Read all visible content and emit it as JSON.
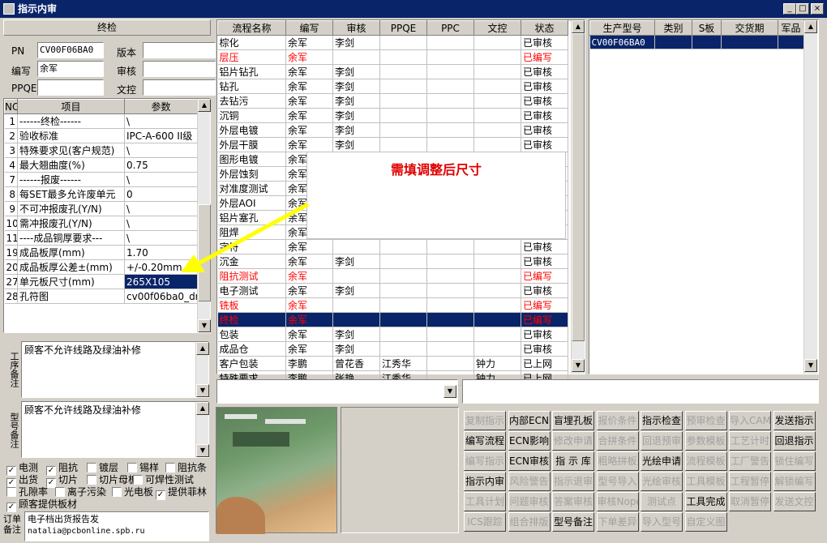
{
  "window": {
    "title": "指示内审",
    "min": "_",
    "max": "□",
    "close": "×"
  },
  "left_panel": {
    "section": "终检",
    "fields": [
      {
        "label": "PN",
        "value": "CV00F06BA0"
      },
      {
        "label": "版本",
        "value": ""
      },
      {
        "label": "编写",
        "value": "余军"
      },
      {
        "label": "审核",
        "value": ""
      },
      {
        "label": "PPQE",
        "value": ""
      },
      {
        "label": "文控",
        "value": ""
      }
    ],
    "params_headers": [
      "NO",
      "项目",
      "参数"
    ],
    "params": [
      {
        "no": "1",
        "item": "------终检------",
        "value": "\\"
      },
      {
        "no": "2",
        "item": "验收标准",
        "value": "IPC-A-600 II级"
      },
      {
        "no": "3",
        "item": "特殊要求见(客户规范)",
        "value": "\\"
      },
      {
        "no": "4",
        "item": "最大翘曲度(%)",
        "value": "0.75"
      },
      {
        "no": "7",
        "item": "------报废------",
        "value": "\\"
      },
      {
        "no": "8",
        "item": "每SET最多允许废单元",
        "value": "0"
      },
      {
        "no": "9",
        "item": "不可冲报废孔(Y/N)",
        "value": "\\"
      },
      {
        "no": "10",
        "item": "需冲报废孔(Y/N)",
        "value": "\\"
      },
      {
        "no": "11",
        "item": "----成品铜厚要求---",
        "value": "\\"
      },
      {
        "no": "19",
        "item": "成品板厚(mm)",
        "value": "1.70"
      },
      {
        "no": "20",
        "item": "成品板厚公差±(mm)",
        "value": "+/-0.20mm"
      },
      {
        "no": "27",
        "item": "单元板尺寸(mm)",
        "value": "265X105"
      },
      {
        "no": "28",
        "item": "孔符图",
        "value": "cv00f06ba0_drl"
      }
    ],
    "process_note_label": "工序备注",
    "process_note": "顾客不允许线路及绿油补修",
    "model_note_label": "型号备注",
    "model_note": "顾客不允许线路及绿油补修",
    "checkboxes": [
      [
        {
          "label": "电测",
          "checked": true
        },
        {
          "label": "阻抗",
          "checked": true
        },
        {
          "label": "镀层",
          "checked": false
        },
        {
          "label": "锡样",
          "checked": false
        },
        {
          "label": "阻抗条",
          "checked": false
        }
      ],
      [
        {
          "label": "出货",
          "checked": true
        },
        {
          "label": "切片",
          "checked": true
        },
        {
          "label": "切片母板",
          "checked": false
        },
        {
          "label": "可焊性测试",
          "checked": false
        }
      ],
      [
        {
          "label": "孔隙率",
          "checked": false
        },
        {
          "label": "离子污染",
          "checked": false
        },
        {
          "label": "光电板",
          "checked": false
        },
        {
          "label": "提供菲林",
          "checked": true
        }
      ],
      [
        {
          "label": "顾客提供板材",
          "checked": true
        }
      ]
    ],
    "order_note_label": "订单备注",
    "order_note_lines": [
      "电子档出货报告发",
      "natalia@pcbonline.spb.ru"
    ]
  },
  "process_table": {
    "headers": [
      "流程名称",
      "编写",
      "审核",
      "PPQE",
      "PPC",
      "文控",
      "状态"
    ],
    "rows": [
      {
        "name": "棕化",
        "writer": "余军",
        "reviewer": "李剑",
        "ppqe": "",
        "ppc": "",
        "dc": "",
        "status": "已审核",
        "style": ""
      },
      {
        "name": "层压",
        "writer": "余军",
        "reviewer": "",
        "ppqe": "",
        "ppc": "",
        "dc": "",
        "status": "已编写",
        "style": "red"
      },
      {
        "name": "铝片钻孔",
        "writer": "余军",
        "reviewer": "李剑",
        "ppqe": "",
        "ppc": "",
        "dc": "",
        "status": "已审核",
        "style": ""
      },
      {
        "name": "钻孔",
        "writer": "余军",
        "reviewer": "李剑",
        "ppqe": "",
        "ppc": "",
        "dc": "",
        "status": "已审核",
        "style": ""
      },
      {
        "name": "去钻污",
        "writer": "余军",
        "reviewer": "李剑",
        "ppqe": "",
        "ppc": "",
        "dc": "",
        "status": "已审核",
        "style": ""
      },
      {
        "name": "沉铜",
        "writer": "余军",
        "reviewer": "李剑",
        "ppqe": "",
        "ppc": "",
        "dc": "",
        "status": "已审核",
        "style": ""
      },
      {
        "name": "外层电镀",
        "writer": "余军",
        "reviewer": "李剑",
        "ppqe": "",
        "ppc": "",
        "dc": "",
        "status": "已审核",
        "style": ""
      },
      {
        "name": "外层干膜",
        "writer": "余军",
        "reviewer": "李剑",
        "ppqe": "",
        "ppc": "",
        "dc": "",
        "status": "已审核",
        "style": ""
      },
      {
        "name": "图形电镀",
        "writer": "余军",
        "reviewer": "李剑",
        "ppqe": "",
        "ppc": "",
        "dc": "",
        "status": "已审核",
        "style": ""
      },
      {
        "name": "外层蚀刻",
        "writer": "余军",
        "reviewer": "",
        "ppqe": "",
        "ppc": "",
        "dc": "",
        "status": "已审核",
        "style": ""
      },
      {
        "name": "对准度测试",
        "writer": "余军",
        "reviewer": "",
        "ppqe": "",
        "ppc": "",
        "dc": "",
        "status": "已审核",
        "style": ""
      },
      {
        "name": "外层AOI",
        "writer": "余军",
        "reviewer": "",
        "ppqe": "",
        "ppc": "",
        "dc": "",
        "status": "已审核",
        "style": ""
      },
      {
        "name": "铝片塞孔",
        "writer": "余军",
        "reviewer": "",
        "ppqe": "",
        "ppc": "",
        "dc": "",
        "status": "已审核",
        "style": ""
      },
      {
        "name": "阻焊",
        "writer": "余军",
        "reviewer": "",
        "ppqe": "",
        "ppc": "",
        "dc": "",
        "status": "已审核",
        "style": ""
      },
      {
        "name": "字符",
        "writer": "余军",
        "reviewer": "",
        "ppqe": "",
        "ppc": "",
        "dc": "",
        "status": "已审核",
        "style": ""
      },
      {
        "name": "沉金",
        "writer": "余军",
        "reviewer": "李剑",
        "ppqe": "",
        "ppc": "",
        "dc": "",
        "status": "已审核",
        "style": ""
      },
      {
        "name": "阻抗测试",
        "writer": "余军",
        "reviewer": "",
        "ppqe": "",
        "ppc": "",
        "dc": "",
        "status": "已编写",
        "style": "red"
      },
      {
        "name": "电子测试",
        "writer": "余军",
        "reviewer": "李剑",
        "ppqe": "",
        "ppc": "",
        "dc": "",
        "status": "已审核",
        "style": ""
      },
      {
        "name": "铣板",
        "writer": "余军",
        "reviewer": "",
        "ppqe": "",
        "ppc": "",
        "dc": "",
        "status": "已编写",
        "style": "red"
      },
      {
        "name": "终检",
        "writer": "余军",
        "reviewer": "",
        "ppqe": "",
        "ppc": "",
        "dc": "",
        "status": "已编写",
        "style": "sel"
      },
      {
        "name": "包装",
        "writer": "余军",
        "reviewer": "李剑",
        "ppqe": "",
        "ppc": "",
        "dc": "",
        "status": "已审核",
        "style": ""
      },
      {
        "name": "成品仓",
        "writer": "余军",
        "reviewer": "李剑",
        "ppqe": "",
        "ppc": "",
        "dc": "",
        "status": "已审核",
        "style": ""
      },
      {
        "name": "客户包装",
        "writer": "李鹏",
        "reviewer": "曾花香",
        "ppqe": "江秀华",
        "ppc": "",
        "dc": "钟力",
        "status": "已上网",
        "style": ""
      },
      {
        "name": "特殊要求",
        "writer": "李鹏",
        "reviewer": "张艳",
        "ppqe": "江秀华",
        "ppc": "",
        "dc": "钟力",
        "status": "已上网",
        "style": ""
      }
    ]
  },
  "annotation": {
    "text": "需填调整后尺寸",
    "color": "#e00000",
    "arrow_color": "#ffff00"
  },
  "product_table": {
    "headers": [
      "生产型号",
      "类别",
      "S板",
      "交货期",
      "军品"
    ],
    "rows": [
      {
        "model": "CV00F06BA0",
        "type": "",
        "s": "",
        "due": "",
        "mil": ""
      }
    ]
  },
  "photo": {
    "description_icon": "pcb-photo"
  },
  "buttons": [
    [
      {
        "label": "复制指示",
        "enabled": false
      },
      {
        "label": "内部ECN",
        "enabled": true
      },
      {
        "label": "盲埋孔板",
        "enabled": true
      },
      {
        "label": "报价条件",
        "enabled": false
      },
      {
        "label": "指示检查",
        "enabled": true
      },
      {
        "label": "预审检查",
        "enabled": false
      },
      {
        "label": "导入CAM",
        "enabled": false
      },
      {
        "label": "发送指示",
        "enabled": true
      }
    ],
    [
      {
        "label": "编写流程",
        "enabled": true
      },
      {
        "label": "ECN影响",
        "enabled": true
      },
      {
        "label": "修改申请",
        "enabled": false
      },
      {
        "label": "合拼条件",
        "enabled": false
      },
      {
        "label": "回退预审",
        "enabled": false
      },
      {
        "label": "参数模板",
        "enabled": false
      },
      {
        "label": "工艺计时",
        "enabled": false
      },
      {
        "label": "回退指示",
        "enabled": true
      }
    ],
    [
      {
        "label": "编写指示",
        "enabled": false
      },
      {
        "label": "ECN审核",
        "enabled": true
      },
      {
        "label": "指 示 库",
        "enabled": true
      },
      {
        "label": "粗略拼板",
        "enabled": false
      },
      {
        "label": "光绘申请",
        "enabled": true
      },
      {
        "label": "流程模板",
        "enabled": false
      },
      {
        "label": "工厂警告",
        "enabled": false
      },
      {
        "label": "锁住编写",
        "enabled": false
      }
    ],
    [
      {
        "label": "指示内审",
        "enabled": true
      },
      {
        "label": "风险警告",
        "enabled": false
      },
      {
        "label": "指示退审",
        "enabled": false
      },
      {
        "label": "型号导入",
        "enabled": false
      },
      {
        "label": "光绘审核",
        "enabled": false
      },
      {
        "label": "工具模板",
        "enabled": false
      },
      {
        "label": "工程暂停",
        "enabled": false
      },
      {
        "label": "解锁编写",
        "enabled": false
      }
    ],
    [
      {
        "label": "工具计划",
        "enabled": false
      },
      {
        "label": "问题审核",
        "enabled": false
      },
      {
        "label": "答案审核",
        "enabled": false
      },
      {
        "label": "审核Nope",
        "enabled": false
      },
      {
        "label": "测试点",
        "enabled": false
      },
      {
        "label": "工具完成",
        "enabled": true
      },
      {
        "label": "取消暂停",
        "enabled": false
      },
      {
        "label": "发送文控",
        "enabled": false
      }
    ],
    [
      {
        "label": "ICS跟踪",
        "enabled": false
      },
      {
        "label": "组合排版",
        "enabled": false
      },
      {
        "label": "型号备注",
        "enabled": true
      },
      {
        "label": "下单差异",
        "enabled": false
      },
      {
        "label": "导入型号",
        "enabled": false
      },
      {
        "label": "自定义图",
        "enabled": false
      }
    ]
  ]
}
